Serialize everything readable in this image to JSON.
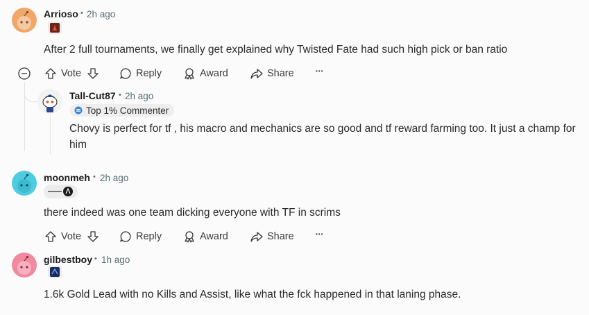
{
  "comments": [
    {
      "username": "Arrioso",
      "time": "2h ago",
      "body": "After 2 full tournaments, we finally get explained why Twisted Fate had such high pick or ban ratio",
      "avatar_color": "#f0a868"
    },
    {
      "username": "Tall-Cut87",
      "time": "2h ago",
      "badge": "Top 1% Commenter",
      "body": "Chovy is perfect for tf , his macro and mechanics are so good and tf reward farming too. It just a champ for him"
    },
    {
      "username": "moonmeh",
      "time": "2h ago",
      "body": "there indeed was one team dicking everyone with TF in scrims",
      "avatar_color": "#4fcde0"
    },
    {
      "username": "gilbestboy",
      "time": "1h ago",
      "body": "1.6k Gold Lead with no Kills and Assist, like what the fck happened in that laning phase.",
      "avatar_color": "#f08aa0"
    }
  ],
  "actions": {
    "vote": "Vote",
    "reply": "Reply",
    "award": "Award",
    "share": "Share",
    "more": "•••"
  },
  "separator": "•"
}
